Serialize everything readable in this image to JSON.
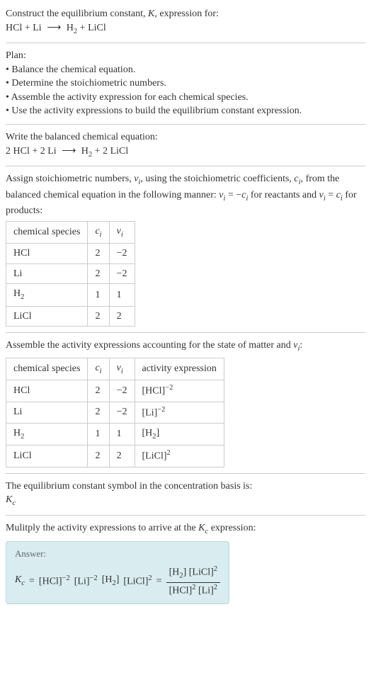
{
  "intro": {
    "line1_prefix": "Construct the equilibrium constant, ",
    "line1_K": "K",
    "line1_suffix": ", expression for:",
    "eq_lhs1": "HCl",
    "eq_plus": " + ",
    "eq_lhs2": "Li",
    "eq_arrow": "⟶",
    "eq_rhs1": "H",
    "eq_rhs1_sub": "2",
    "eq_rhs2": "LiCl"
  },
  "plan": {
    "title": "Plan:",
    "b1": "• Balance the chemical equation.",
    "b2": "• Determine the stoichiometric numbers.",
    "b3": "• Assemble the activity expression for each chemical species.",
    "b4": "• Use the activity expressions to build the equilibrium constant expression."
  },
  "balanced": {
    "title": "Write the balanced chemical equation:",
    "c1": "2 HCl",
    "c2": "2 Li",
    "c3a": "H",
    "c3b": "2",
    "c4": "2 LiCl",
    "plus": " + ",
    "arrow": "⟶"
  },
  "assign": {
    "text1": "Assign stoichiometric numbers, ",
    "nu": "ν",
    "sub_i": "i",
    "text2": ", using the stoichiometric coefficients, ",
    "c": "c",
    "text3": ", from the balanced chemical equation in the following manner: ",
    "eq1a": "ν",
    "eq1b": " = −",
    "eq1c": "c",
    "text4": " for reactants and ",
    "eq2a": "ν",
    "eq2b": " = ",
    "eq2c": "c",
    "text5": " for products:"
  },
  "table1": {
    "h1": "chemical species",
    "h2": "c",
    "h2sub": "i",
    "h3": "ν",
    "h3sub": "i",
    "rows": [
      {
        "s": "HCl",
        "c": "2",
        "n": "−2"
      },
      {
        "s": "Li",
        "c": "2",
        "n": "−2"
      },
      {
        "s": "H",
        "ssub": "2",
        "c": "1",
        "n": "1"
      },
      {
        "s": "LiCl",
        "c": "2",
        "n": "2"
      }
    ]
  },
  "assemble": {
    "text1": "Assemble the activity expressions accounting for the state of matter and ",
    "nu": "ν",
    "sub_i": "i",
    "text2": ":"
  },
  "table2": {
    "h1": "chemical species",
    "h2": "c",
    "h2sub": "i",
    "h3": "ν",
    "h3sub": "i",
    "h4": "activity expression",
    "rows": [
      {
        "s": "HCl",
        "c": "2",
        "n": "−2",
        "a": "[HCl]",
        "asup": "−2"
      },
      {
        "s": "Li",
        "c": "2",
        "n": "−2",
        "a": "[Li]",
        "asup": "−2"
      },
      {
        "s": "H",
        "ssub": "2",
        "c": "1",
        "n": "1",
        "a": "[H",
        "amid": "2",
        "aend": "]"
      },
      {
        "s": "LiCl",
        "c": "2",
        "n": "2",
        "a": "[LiCl]",
        "asup": "2"
      }
    ]
  },
  "symbol": {
    "text": "The equilibrium constant symbol in the concentration basis is:",
    "K": "K",
    "c": "c"
  },
  "multiply": {
    "text1": "Mulitply the activity expressions to arrive at the ",
    "K": "K",
    "c": "c",
    "text2": " expression:"
  },
  "answer": {
    "label": "Answer:",
    "Kc_K": "K",
    "Kc_c": "c",
    "eq": " = ",
    "t1": "[HCl]",
    "t1s": "−2",
    "t2": "[Li]",
    "t2s": "−2",
    "t3a": "[H",
    "t3b": "2",
    "t3c": "]",
    "t4": "[LiCl]",
    "t4s": "2",
    "eq2": " = ",
    "num1a": "[H",
    "num1b": "2",
    "num1c": "]",
    "num2": "[LiCl]",
    "num2s": "2",
    "den1": "[HCl]",
    "den1s": "2",
    "den2": "[Li]",
    "den2s": "2"
  }
}
